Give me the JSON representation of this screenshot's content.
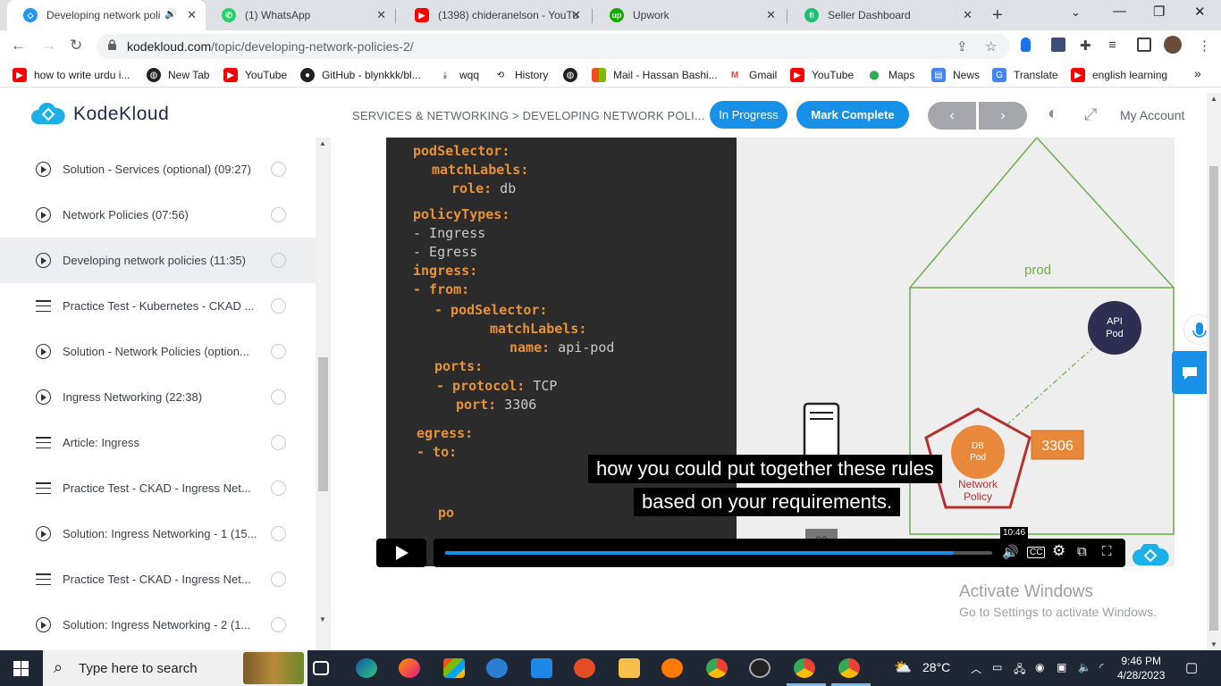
{
  "browser": {
    "tabs": [
      {
        "title": "Developing network poli",
        "active": true
      },
      {
        "title": "(1) WhatsApp",
        "active": false
      },
      {
        "title": "(1398) chideranelson - YouTu",
        "active": false
      },
      {
        "title": "Upwork",
        "active": false
      },
      {
        "title": "Seller Dashboard",
        "active": false
      }
    ],
    "url_host": "kodekloud.com",
    "url_path": "/topic/developing-network-policies-2/",
    "bookmarks": [
      "how to write urdu i...",
      "New Tab",
      "YouTube",
      "GitHub - blynkkk/bl...",
      "wqq",
      "History",
      "",
      "Mail - Hassan Bashi...",
      "Gmail",
      "YouTube",
      "Maps",
      "News",
      "Translate",
      "english learning"
    ]
  },
  "site": {
    "brand": "KodeKloud",
    "breadcrumb": "SERVICES & NETWORKING > DEVELOPING NETWORK POLI...",
    "status_button": "In Progress",
    "complete_button": "Mark Complete",
    "account": "My Account"
  },
  "sidebar": {
    "lessons": [
      {
        "title": "Solution - Services (optional) (09:27)",
        "type": "video"
      },
      {
        "title": "Network Policies (07:56)",
        "type": "video"
      },
      {
        "title": "Developing network policies (11:35)",
        "type": "video",
        "current": true
      },
      {
        "title": "Practice Test - Kubernetes - CKAD ...",
        "type": "doc"
      },
      {
        "title": "Solution - Network Policies (option...",
        "type": "video"
      },
      {
        "title": "Ingress Networking (22:38)",
        "type": "video"
      },
      {
        "title": "Article: Ingress",
        "type": "doc"
      },
      {
        "title": "Practice Test - CKAD - Ingress Net...",
        "type": "doc"
      },
      {
        "title": "Solution: Ingress Networking - 1 (15...",
        "type": "video"
      },
      {
        "title": "Practice Test - CKAD - Ingress Net...",
        "type": "doc"
      },
      {
        "title": "Solution: Ingress Networking - 2 (1...",
        "type": "video"
      }
    ]
  },
  "video": {
    "code_lines": [
      {
        "key": "podSelector:",
        "val": ""
      },
      {
        "key": "matchLabels:",
        "val": ""
      },
      {
        "key": "role:",
        "val": " db"
      },
      {
        "key": "policyTypes:",
        "val": ""
      },
      {
        "key": "",
        "val": "- Ingress"
      },
      {
        "key": "",
        "val": "- Egress"
      },
      {
        "key": "ingress:",
        "val": ""
      },
      {
        "key": "- from:",
        "val": ""
      },
      {
        "key": "- podSelector:",
        "val": ""
      },
      {
        "key": "matchLabels:",
        "val": ""
      },
      {
        "key": "name:",
        "val": " api-pod"
      },
      {
        "key": "ports:",
        "val": ""
      },
      {
        "key": "- protocol:",
        "val": " TCP"
      },
      {
        "key": "port:",
        "val": " 3306"
      },
      {
        "key": "egress:",
        "val": ""
      },
      {
        "key": "- to:",
        "val": ""
      },
      {
        "key": "po",
        "val": ""
      }
    ],
    "diagram": {
      "namespace": "prod",
      "api_pod": [
        "API",
        "Pod"
      ],
      "db_pod": [
        "DB",
        "Pod"
      ],
      "policy": [
        "Network",
        "Policy"
      ],
      "port_box": "3306",
      "server_port": "80"
    },
    "subtitle_lines": [
      "how you could put together these rules",
      "based on your requirements."
    ],
    "hover_time": "10:46",
    "progress": 0.93
  },
  "watermark": {
    "line1": "Activate Windows",
    "line2": "Go to Settings to activate Windows."
  },
  "taskbar": {
    "search_placeholder": "Type here to search",
    "weather": "28°C",
    "time": "9:46 PM",
    "date": "4/28/2023"
  }
}
